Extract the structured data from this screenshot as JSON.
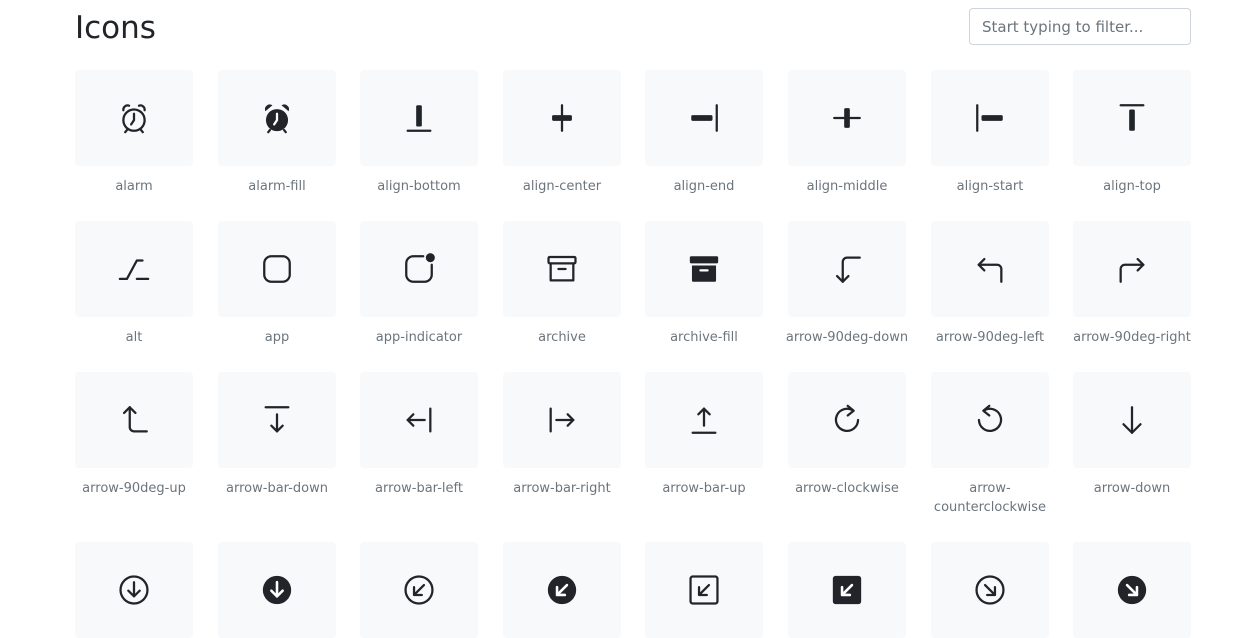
{
  "header": {
    "title": "Icons",
    "filter_placeholder": "Start typing to filter..."
  },
  "icons": [
    {
      "name": "alarm",
      "label": "alarm"
    },
    {
      "name": "alarm-fill",
      "label": "alarm-fill"
    },
    {
      "name": "align-bottom",
      "label": "align-bottom"
    },
    {
      "name": "align-center",
      "label": "align-center"
    },
    {
      "name": "align-end",
      "label": "align-end"
    },
    {
      "name": "align-middle",
      "label": "align-middle"
    },
    {
      "name": "align-start",
      "label": "align-start"
    },
    {
      "name": "align-top",
      "label": "align-top"
    },
    {
      "name": "alt",
      "label": "alt"
    },
    {
      "name": "app",
      "label": "app"
    },
    {
      "name": "app-indicator",
      "label": "app-indicator"
    },
    {
      "name": "archive",
      "label": "archive"
    },
    {
      "name": "archive-fill",
      "label": "archive-fill"
    },
    {
      "name": "arrow-90deg-down",
      "label": "arrow-90deg-down"
    },
    {
      "name": "arrow-90deg-left",
      "label": "arrow-90deg-left"
    },
    {
      "name": "arrow-90deg-right",
      "label": "arrow-90deg-right"
    },
    {
      "name": "arrow-90deg-up",
      "label": "arrow-90deg-up"
    },
    {
      "name": "arrow-bar-down",
      "label": "arrow-bar-down"
    },
    {
      "name": "arrow-bar-left",
      "label": "arrow-bar-left"
    },
    {
      "name": "arrow-bar-right",
      "label": "arrow-bar-right"
    },
    {
      "name": "arrow-bar-up",
      "label": "arrow-bar-up"
    },
    {
      "name": "arrow-clockwise",
      "label": "arrow-clockwise"
    },
    {
      "name": "arrow-counterclockwise",
      "label": "arrow-counterclockwise"
    },
    {
      "name": "arrow-down",
      "label": "arrow-down"
    },
    {
      "name": "arrow-down-circle",
      "label": ""
    },
    {
      "name": "arrow-down-circle-fill",
      "label": ""
    },
    {
      "name": "arrow-down-left-circle",
      "label": ""
    },
    {
      "name": "arrow-down-left-circle-fill",
      "label": ""
    },
    {
      "name": "arrow-down-left-square",
      "label": ""
    },
    {
      "name": "arrow-down-left-square-fill",
      "label": ""
    },
    {
      "name": "arrow-down-right-circle",
      "label": ""
    },
    {
      "name": "arrow-down-right-circle-fill",
      "label": ""
    }
  ]
}
